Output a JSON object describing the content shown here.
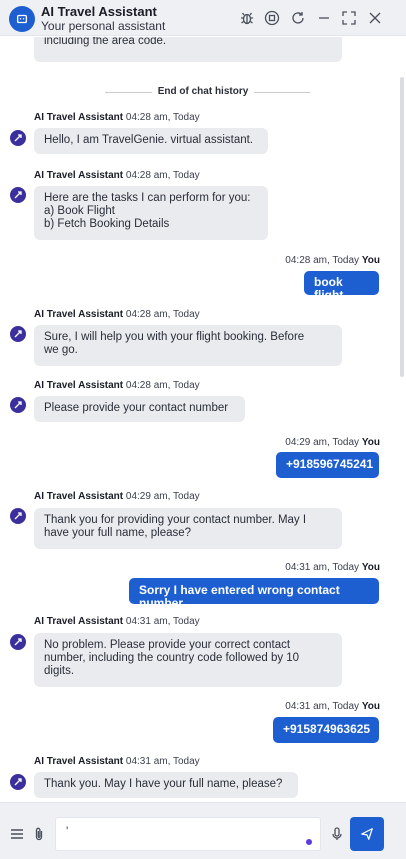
{
  "header": {
    "title": "AI Travel Assistant",
    "subtitle": "Your personal assistant"
  },
  "chat": {
    "truncated_text": "including the area code.",
    "divider": "End of chat history",
    "bot_name": "AI Travel Assistant",
    "user_name": "You",
    "messages": [
      {
        "time": "04:28 am, Today",
        "text": "Hello, I am TravelGenie. virtual assistant."
      },
      {
        "time": "04:28 am, Today",
        "line1": "Here are the tasks I can perform for you:",
        "line2": "a) Book Flight",
        "line3": "b) Fetch Booking Details"
      },
      {
        "time": "04:28 am, Today",
        "text": "book flight"
      },
      {
        "time": "04:28 am, Today",
        "line1": "Sure, I will help you with your flight booking. Before",
        "line2": "we go."
      },
      {
        "time": "04:28 am, Today",
        "text": "Please provide your contact number"
      },
      {
        "time": "04:29 am, Today",
        "text": "+918596745241"
      },
      {
        "time": "04:29 am, Today",
        "line1": "Thank you for providing your contact number. May I",
        "line2": "have your full name, please?"
      },
      {
        "time": "04:31 am, Today",
        "text": "Sorry I have entered wrong contact number"
      },
      {
        "time": "04:31 am, Today",
        "line1": "No problem. Please provide your correct contact",
        "line2": "number, including the country code followed by 10",
        "line3": "digits."
      },
      {
        "time": "04:31 am, Today",
        "text": "+915874963625"
      },
      {
        "time": "04:31 am, Today",
        "text": "Thank you. May I have your full name, please?"
      }
    ]
  },
  "composer": {
    "value": "'"
  },
  "colors": {
    "accent": "#1d5fd0",
    "bot_bubble": "#e9ebef",
    "bot_avatar": "#3a2f9c"
  },
  "icons": {
    "header": [
      "chat-icon",
      "bug-icon",
      "stop-icon",
      "refresh-icon",
      "minimize-icon",
      "expand-icon",
      "close-icon"
    ],
    "footer": [
      "menu-icon",
      "attachment-icon",
      "microphone-icon",
      "send-icon"
    ]
  }
}
